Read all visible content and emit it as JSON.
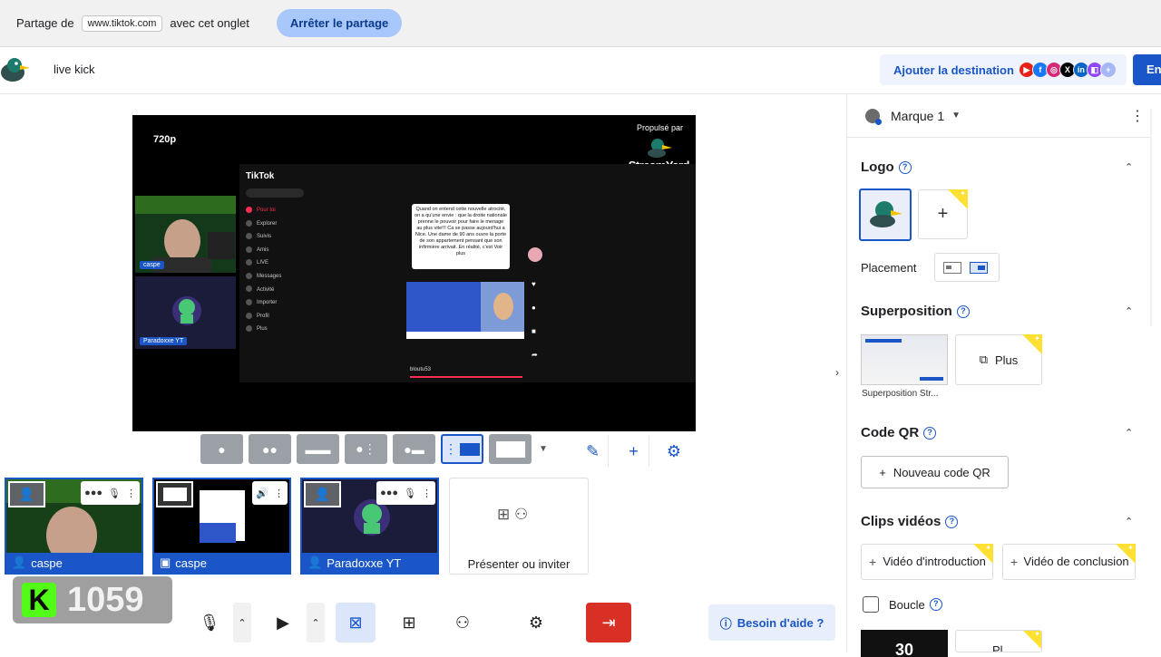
{
  "share_bar": {
    "prefix": "Partage de",
    "site": "www.tiktok.com",
    "suffix": "avec cet onglet",
    "stop_label": "Arrêter le partage"
  },
  "header": {
    "broadcast_title": "live kick",
    "add_destination_label": "Ajouter la destination",
    "destination_icons": [
      "youtube-icon",
      "facebook-icon",
      "instagram-icon",
      "x-icon",
      "linkedin-icon",
      "twitch-icon",
      "add-icon"
    ],
    "go_live_label": "En"
  },
  "stage": {
    "resolution": "720p",
    "powered_by": "Propulsé par",
    "powered_brand": "StreamYard",
    "cam1_name": "caspe",
    "cam2_name": "Paradoxxe YT",
    "tiktok": {
      "logo": "TikTok",
      "nav_items": [
        "Pour toi",
        "Explorer",
        "Suivis",
        "Amis",
        "LIVE",
        "Messages",
        "Activité",
        "Importer",
        "Profil",
        "Plus"
      ],
      "caption": "Quand on entend cette nouvelle atrocité, on a qu'une envie : que la droite nationale prenne le pouvoir pour faire le menage au plus vite!!! Ca se passe aujourd'hui a Nice. Une dame de 90 ans ouvre la porte de son appartement pensant que son infirmière arrivait. En réalité, c'est Voir plus",
      "username": "bloutu53"
    }
  },
  "layout_bar": {
    "layouts": [
      "solo",
      "cropped",
      "group",
      "news",
      "screen",
      "pip",
      "full-screen"
    ],
    "selected_index": 5
  },
  "sources": [
    {
      "name": "caspe",
      "type": "camera"
    },
    {
      "name": "caspe",
      "type": "screen"
    },
    {
      "name": "Paradoxxe YT",
      "type": "camera"
    }
  ],
  "invite_label": "Présenter ou inviter",
  "viewer_counter": {
    "letter": "K",
    "count": "1059"
  },
  "help_label": "Besoin d'aide ?",
  "panel": {
    "brand_name": "Marque 1",
    "logo_title": "Logo",
    "placement_label": "Placement",
    "overlay_title": "Superposition",
    "overlay_caption": "Superposition Str...",
    "more_label": "Plus",
    "qr_title": "Code QR",
    "qr_button": "Nouveau code QR",
    "clips_title": "Clips vidéos",
    "intro_label": "Vidéo d'introduction",
    "outro_label": "Vidéo de conclusion",
    "loop_label": "Boucle",
    "timer_text": "30",
    "more_label_2": "Pl"
  }
}
